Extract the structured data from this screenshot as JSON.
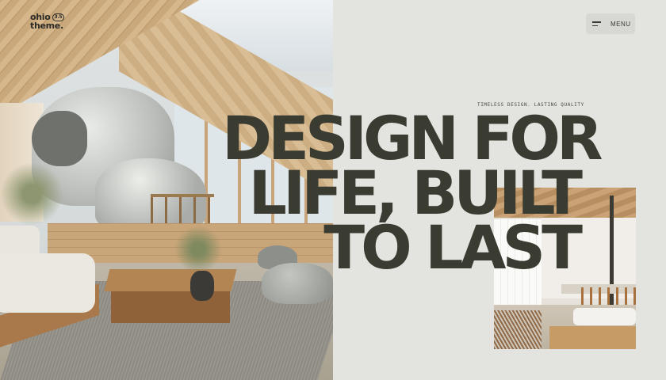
{
  "logo": {
    "line1": "ohio",
    "badge": "3.5",
    "line2": "theme."
  },
  "menu": {
    "icon": "hamburger-icon",
    "label": "MENU"
  },
  "hero": {
    "tagline": "TIMELESS DESIGN. LASTING QUALITY",
    "headline_lines": [
      "DESIGN FOR",
      "LIFE, BUILT",
      "TO LAST"
    ]
  },
  "colors": {
    "background": "#e3e4e0",
    "headline": "#3b3c31",
    "menu_bg": "#d7d8d4"
  }
}
